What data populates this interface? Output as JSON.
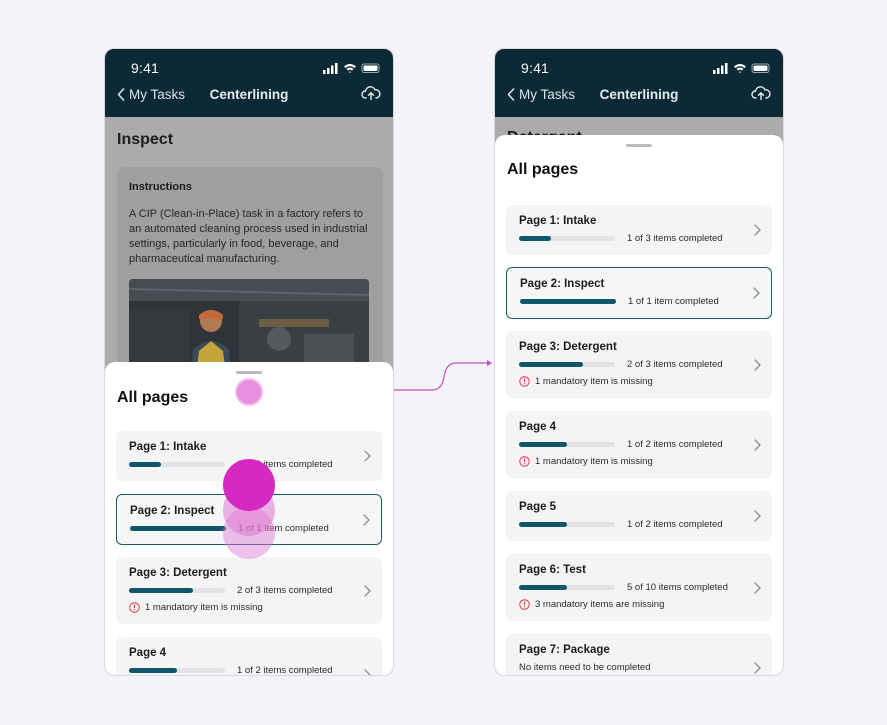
{
  "colors": {
    "nav_bg": "#0c2a36",
    "accent": "#0f566b",
    "warning": "#d93a3a",
    "touch": "#d629c0"
  },
  "status_time": "9:41",
  "nav": {
    "back_label": "My Tasks",
    "title": "Centerlining"
  },
  "left": {
    "bg_title": "Inspect",
    "instructions": {
      "label": "Instructions",
      "text": "A CIP (Clean-in-Place) task in a factory refers to an automated cleaning process used in industrial settings, particularly in food, beverage, and pharmaceutical manufacturing."
    },
    "sheet_title": "All pages",
    "pages": [
      {
        "name": "Page 1: Intake",
        "count": "1 of 3 items completed",
        "progress": 0.33
      },
      {
        "name": "Page 2: Inspect",
        "count": "1 of 1 item completed",
        "progress": 1.0,
        "selected": true
      },
      {
        "name": "Page 3: Detergent",
        "count": "2 of 3 items completed",
        "progress": 0.67,
        "note": "1 mandatory item is missing"
      },
      {
        "name": "Page 4",
        "count": "1 of 2 items completed",
        "progress": 0.5
      }
    ]
  },
  "right": {
    "bg_title": "Detergent",
    "sheet_title": "All pages",
    "pages": [
      {
        "name": "Page 1: Intake",
        "count": "1 of 3 items completed",
        "progress": 0.33
      },
      {
        "name": "Page 2: Inspect",
        "count": "1 of 1 item completed",
        "progress": 1.0,
        "selected": true
      },
      {
        "name": "Page 3: Detergent",
        "count": "2 of 3 items completed",
        "progress": 0.67,
        "note": "1 mandatory item is missing"
      },
      {
        "name": "Page 4",
        "count": "1 of 2 items completed",
        "progress": 0.5,
        "note": "1 mandatory item is missing"
      },
      {
        "name": "Page 5",
        "count": "1 of 2 items completed",
        "progress": 0.5
      },
      {
        "name": "Page 6: Test",
        "count": "5 of 10 items completed",
        "progress": 0.5,
        "note": "3 mandatory items are missing"
      },
      {
        "name": "Page 7: Package",
        "note_plain": "No items need to be completed"
      }
    ]
  }
}
